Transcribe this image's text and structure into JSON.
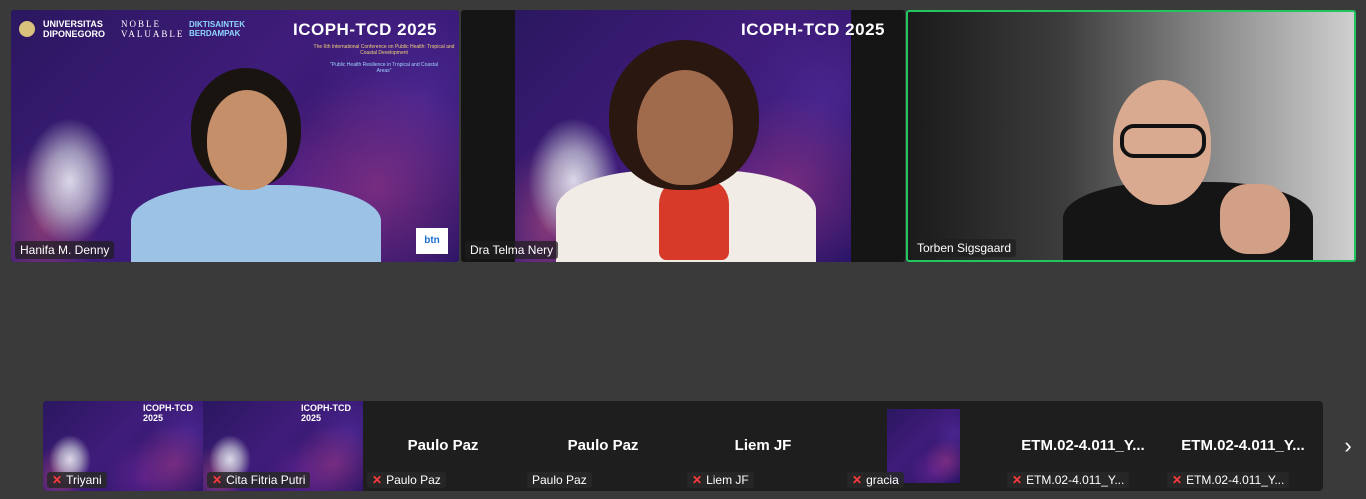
{
  "conference": {
    "university": "UNIVERSITAS DIPONEGORO",
    "noble": "NOBLE VALUABLE",
    "dikti": "DIKTISAINTEK BERDAMPAK",
    "title": "ICOPH-TCD 2025",
    "subtitle": "The 6th International Conference on Public Health: Tropical and Coastal Development",
    "theme": "\"Public Health Resilience in Tropical and Coastal Areas\""
  },
  "main_tiles": [
    {
      "name": "Hanifa M. Denny",
      "badge": "btn"
    },
    {
      "name": "Dra Telma Nery"
    },
    {
      "name": "Torben Sigsgaard",
      "active": true
    }
  ],
  "strip": [
    {
      "name": "Triyani",
      "muted": true
    },
    {
      "name": "Cita Fitria Putri",
      "muted": true
    },
    {
      "label": "Paulo Paz",
      "name": "Paulo Paz",
      "muted": true
    },
    {
      "label": "Paulo Paz",
      "name": "Paulo Paz",
      "muted": false
    },
    {
      "label": "Liem JF",
      "name": "Liem JF",
      "muted": true
    },
    {
      "name": "gracia",
      "muted": true
    },
    {
      "label": "ETM.02-4.011_Y...",
      "name": "ETM.02-4.011_Y...",
      "muted": true
    },
    {
      "label": "ETM.02-4.011_Y...",
      "name": "ETM.02-4.011_Y...",
      "muted": true
    }
  ],
  "icons": {
    "mute": "mic-off-icon",
    "next": "chevron-right-icon"
  }
}
